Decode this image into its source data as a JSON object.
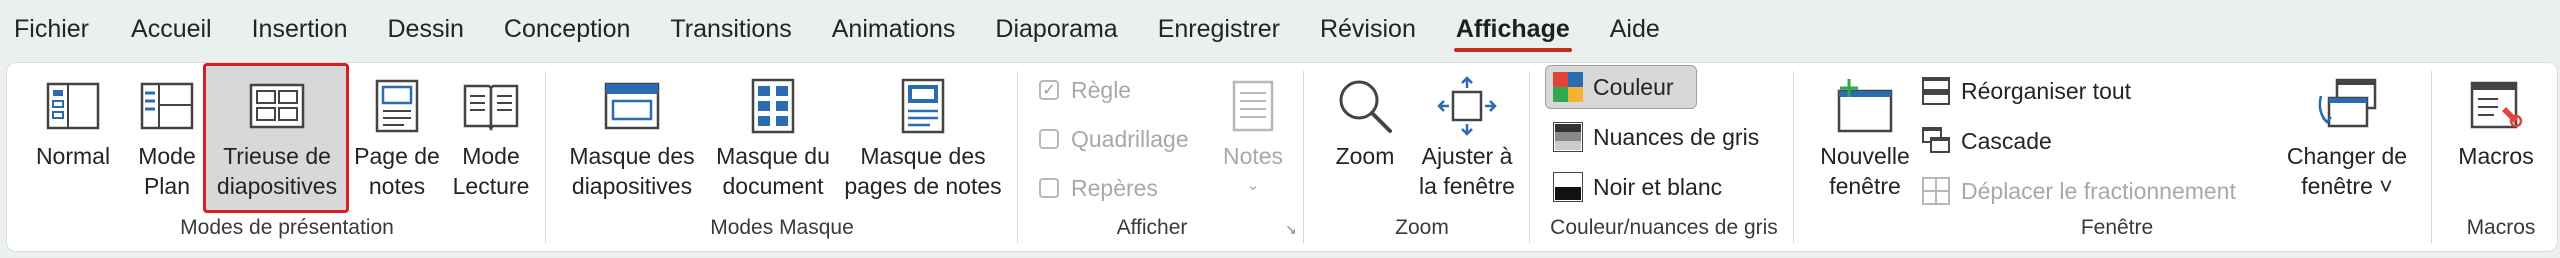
{
  "menu": {
    "items": [
      {
        "label": "Fichier"
      },
      {
        "label": "Accueil"
      },
      {
        "label": "Insertion"
      },
      {
        "label": "Dessin"
      },
      {
        "label": "Conception"
      },
      {
        "label": "Transitions"
      },
      {
        "label": "Animations"
      },
      {
        "label": "Diaporama"
      },
      {
        "label": "Enregistrer"
      },
      {
        "label": "Révision"
      },
      {
        "label": "Affichage"
      },
      {
        "label": "Aide"
      }
    ],
    "active": "Affichage"
  },
  "groups": {
    "presentation": {
      "label": "Modes de présentation",
      "normal": "Normal",
      "plan": [
        "Mode",
        "Plan"
      ],
      "trieuse": [
        "Trieuse de",
        "diapositives"
      ],
      "notes": [
        "Page de",
        "notes"
      ],
      "lecture": [
        "Mode",
        "Lecture"
      ]
    },
    "masque": {
      "label": "Modes Masque",
      "diapo": [
        "Masque des",
        "diapositives"
      ],
      "document": [
        "Masque du",
        "document"
      ],
      "notes": [
        "Masque des",
        "pages de notes"
      ]
    },
    "afficher": {
      "label": "Afficher",
      "regle": "Règle",
      "quadrillage": "Quadrillage",
      "reperes": "Repères",
      "notes": "Notes",
      "launcher": "↘"
    },
    "zoom": {
      "label": "Zoom",
      "zoom": "Zoom",
      "ajuster": [
        "Ajuster à",
        "la fenêtre"
      ]
    },
    "couleur": {
      "label": "Couleur/nuances de gris",
      "couleur": "Couleur",
      "nuances": "Nuances de gris",
      "noir_blanc": "Noir et blanc"
    },
    "fenetre": {
      "label": "Fenêtre",
      "nouvelle": [
        "Nouvelle",
        "fenêtre"
      ],
      "reorganiser": "Réorganiser tout",
      "cascade": "Cascade",
      "deplacer": "Déplacer le fractionnement",
      "changer": [
        "Changer de",
        "fenêtre ˅"
      ]
    },
    "macros": {
      "label": "Macros",
      "macros": "Macros"
    }
  },
  "colors": {
    "accent": "#c42b1c",
    "selection_outline": "#d81e1e",
    "icon_blue": "#2b6cb0"
  }
}
